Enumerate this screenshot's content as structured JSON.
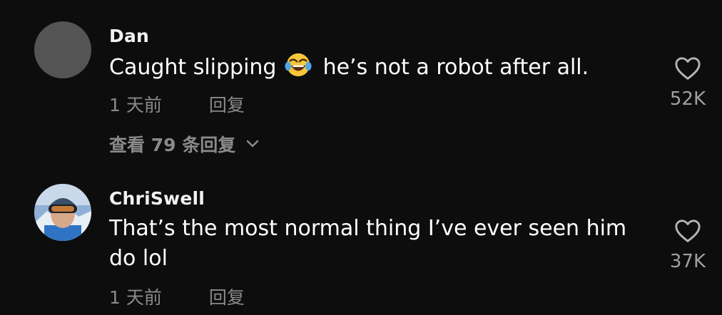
{
  "colors": {
    "background": "#0d0d0d",
    "text": "#ffffff",
    "secondary_text": "#8a8a8a",
    "avatar_placeholder": "#545454"
  },
  "comments": [
    {
      "username": "Dan",
      "text_before_emoji": "Caught slipping",
      "emoji": "tears-of-joy-emoji",
      "text_after_emoji": "he’s not a robot after all.",
      "time": "1 天前",
      "reply_label": "回复",
      "likes": "52K",
      "view_replies_label": "查看 79 条回复",
      "avatar": "gray-placeholder-avatar"
    },
    {
      "username": "ChriSwell",
      "text": "That’s the most normal thing I’ve ever seen him do lol",
      "time": "1 天前",
      "reply_label": "回复",
      "likes": "37K",
      "avatar": "skier-photo-avatar"
    }
  ],
  "icons": {
    "like": "heart-outline-icon",
    "expand": "chevron-down-icon"
  }
}
